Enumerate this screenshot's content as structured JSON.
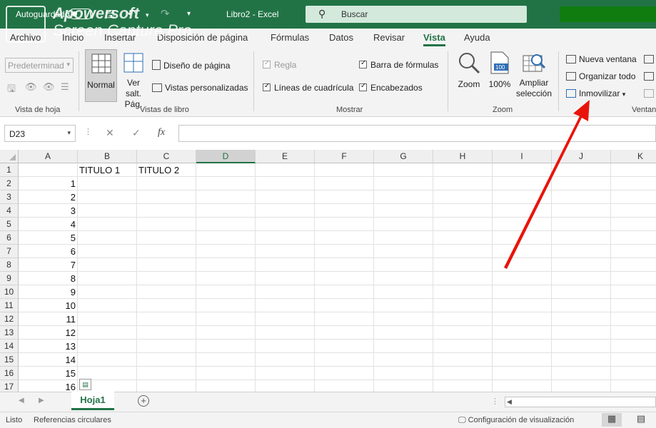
{
  "titlebar": {
    "autosave_label": "Autoguardado",
    "doc_title": "Libro2 - Excel",
    "search_placeholder": "Buscar",
    "undo_icon": "undo-icon",
    "redo_icon": "redo-icon"
  },
  "watermark": {
    "line1": "Apowersoft",
    "line2": "Screen Capture Pro"
  },
  "tabs": [
    "Archivo",
    "Inicio",
    "Insertar",
    "Disposición de página",
    "Fórmulas",
    "Datos",
    "Revisar",
    "Vista",
    "Ayuda"
  ],
  "active_tab": "Vista",
  "ribbon": {
    "sheet_view": {
      "preset": "Predeterminad",
      "label": "Vista de hoja"
    },
    "workbook_views": {
      "normal": "Normal",
      "page_break": "Ver salt. Pág.",
      "page_layout": "Diseño de página",
      "custom_views": "Vistas personalizadas",
      "label": "Vistas de libro"
    },
    "show": {
      "ruler": "Regla",
      "gridlines": "Líneas de cuadrícula",
      "formula_bar": "Barra de fórmulas",
      "headings": "Encabezados",
      "label": "Mostrar"
    },
    "zoom": {
      "zoom": "Zoom",
      "hundred": "100%",
      "zoom_to_selection": "Ampliar selección",
      "label": "Zoom"
    },
    "window": {
      "new_window": "Nueva ventana",
      "arrange_all": "Organizar todo",
      "freeze_panes": "Inmovilizar",
      "label": "Ventan"
    }
  },
  "formula_bar": {
    "name_box": "D23",
    "fx": "fx",
    "value": ""
  },
  "columns": [
    "A",
    "B",
    "C",
    "D",
    "E",
    "F",
    "G",
    "H",
    "I",
    "J",
    "K"
  ],
  "selected_column": "D",
  "rows": [
    "1",
    "2",
    "3",
    "4",
    "5",
    "6",
    "7",
    "8",
    "9",
    "10",
    "11",
    "12",
    "13",
    "14",
    "15",
    "16",
    "17"
  ],
  "cells": {
    "B1": "TITULO 1",
    "C1": "TITULO 2",
    "A_values": [
      "1",
      "2",
      "3",
      "4",
      "5",
      "6",
      "7",
      "8",
      "9",
      "10",
      "11",
      "12",
      "13",
      "14",
      "15",
      "16"
    ]
  },
  "sheets": [
    "Hoja1"
  ],
  "status": {
    "ready": "Listo",
    "circular": "Referencias circulares",
    "display_settings": "Configuración de visualización"
  },
  "colors": {
    "excel_green": "#217346",
    "arrow_red": "#e8140c"
  }
}
